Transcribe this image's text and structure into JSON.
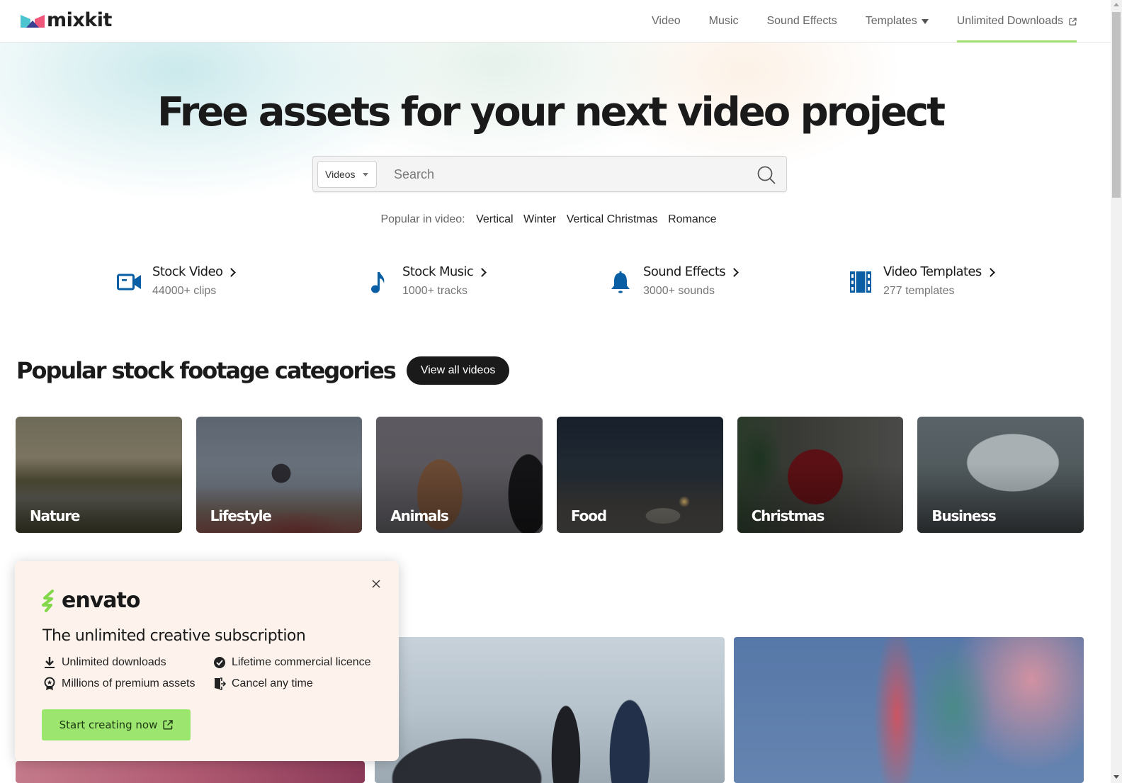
{
  "header": {
    "logo_text": "mixkit",
    "nav": [
      {
        "label": "Video"
      },
      {
        "label": "Music"
      },
      {
        "label": "Sound Effects"
      },
      {
        "label": "Templates",
        "has_dropdown": true
      },
      {
        "label": "Unlimited Downloads",
        "external": true,
        "active": true
      }
    ]
  },
  "hero": {
    "title": "Free assets for your next video project",
    "search": {
      "category_selected": "Videos",
      "placeholder": "Search",
      "value": ""
    },
    "popular_label": "Popular in video:",
    "popular_tags": [
      "Vertical",
      "Winter",
      "Vertical Christmas",
      "Romance"
    ]
  },
  "asset_types": [
    {
      "title": "Stock Video",
      "subtitle": "44000+ clips",
      "icon": "video-camera-icon"
    },
    {
      "title": "Stock Music",
      "subtitle": "1000+ tracks",
      "icon": "music-note-icon"
    },
    {
      "title": "Sound Effects",
      "subtitle": "3000+ sounds",
      "icon": "bell-icon"
    },
    {
      "title": "Video Templates",
      "subtitle": "277 templates",
      "icon": "film-strip-icon"
    }
  ],
  "categories": {
    "title": "Popular stock footage categories",
    "view_all_label": "View all videos",
    "items": [
      {
        "label": "Nature"
      },
      {
        "label": "Lifestyle"
      },
      {
        "label": "Animals"
      },
      {
        "label": "Food"
      },
      {
        "label": "Christmas"
      },
      {
        "label": "Business"
      }
    ]
  },
  "promo": {
    "brand": "envato",
    "title": "The unlimited creative subscription",
    "features": [
      {
        "label": "Unlimited downloads",
        "icon": "download-icon"
      },
      {
        "label": "Lifetime commercial licence",
        "icon": "check-badge-icon"
      },
      {
        "label": "Millions of premium assets",
        "icon": "award-icon"
      },
      {
        "label": "Cancel any time",
        "icon": "exit-door-icon"
      }
    ],
    "cta_label": "Start creating now"
  },
  "colors": {
    "accent_green": "#9fe070",
    "icon_blue": "#0a5fa4",
    "promo_bg": "#fdf3ec",
    "dark_button": "#1a1a1a"
  }
}
